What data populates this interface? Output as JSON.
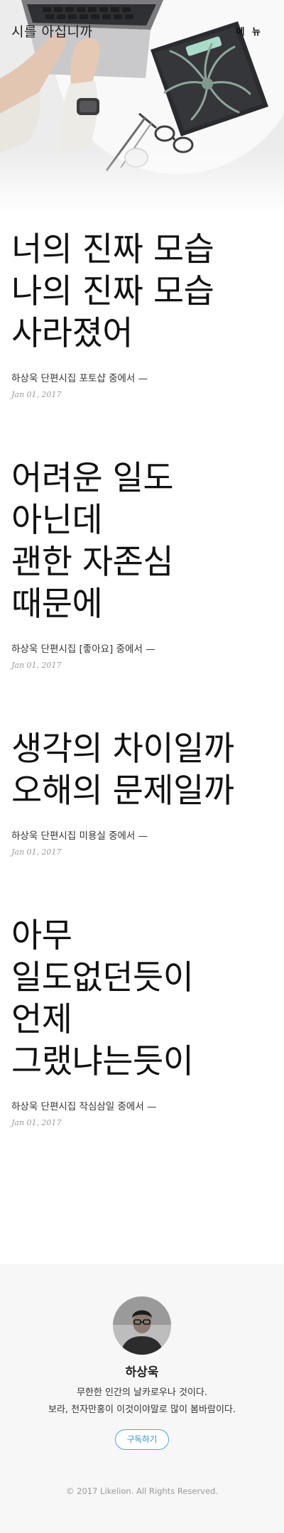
{
  "header": {
    "site_title": "시를 아십니까",
    "menu_label": "메 뉴"
  },
  "posts": [
    {
      "title": "너의 진짜 모습\n나의 진짜 모습\n사라졌어",
      "source": "하상욱 단편시집 포토샵 중에서 —",
      "date": "Jan 01, 2017"
    },
    {
      "title": "어려운 일도\n아닌데\n괜한 자존심\n때문에",
      "source": "하상욱 단편시집 [좋아요] 중에서 —",
      "date": "Jan 01, 2017"
    },
    {
      "title": "생각의 차이일까\n오해의 문제일까",
      "source": "하상욱 단편시집 미용실 중에서 —",
      "date": "Jan 01, 2017"
    },
    {
      "title": "아무\n일도없던듯이\n언제\n그랬냐는듯이",
      "source": "하상욱 단편시집 작심삼일 중에서 —",
      "date": "Jan 01, 2017"
    }
  ],
  "footer": {
    "author_name": "하상욱",
    "author_bio": "무한한 인간의 날카로우나 것이다.\n보라, 천자만홍이 이것이야말로 많이 봄바람이다.",
    "subscribe_label": "구독하기",
    "copyright": "© 2017 Likelion. All Rights Reserved."
  },
  "colors": {
    "accent": "#4aa8d8",
    "footer_background": "#f7f7f7",
    "text": "#111111"
  }
}
